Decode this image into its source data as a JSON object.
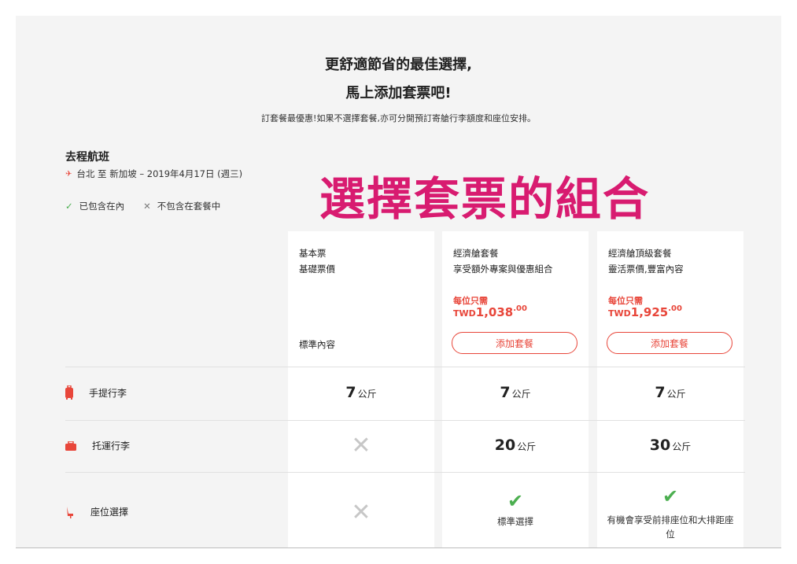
{
  "header": {
    "title_line1": "更舒適節省的最佳選擇,",
    "title_line2": "馬上添加套票吧!",
    "subtitle": "訂套餐最優惠!如果不選擇套餐,亦可分開預訂寄艙行李額度和座位安排。"
  },
  "flight": {
    "title": "去程航班",
    "route": "台北 至 新加坡 – 2019年4月17日 (週三)"
  },
  "legend": {
    "included": "已包含在內",
    "excluded": "不包含在套餐中"
  },
  "overlay_text": "選擇套票的組合",
  "colors": {
    "accent": "#e8463a",
    "check": "#4caf50",
    "overlay": "#d81b70"
  },
  "plans": [
    {
      "name": "基本票",
      "desc": "基礎票價",
      "std": "標準內容"
    },
    {
      "name": "經濟艙套餐",
      "desc": "享受額外專案與優惠組合",
      "price_label": "每位只需",
      "currency": "TWD",
      "amount": "1,038",
      "decimals": ".00",
      "button": "添加套餐"
    },
    {
      "name": "經濟艙頂級套餐",
      "desc": "靈活票價,豐富內容",
      "price_label": "每位只需",
      "currency": "TWD",
      "amount": "1,925",
      "decimals": ".00",
      "button": "添加套餐"
    }
  ],
  "rows": [
    {
      "label": "手提行李",
      "icon": "carry-on-bag-icon",
      "cells": [
        {
          "value": "7",
          "unit": "公斤"
        },
        {
          "value": "7",
          "unit": "公斤"
        },
        {
          "value": "7",
          "unit": "公斤"
        }
      ]
    },
    {
      "label": "托運行李",
      "icon": "checked-bag-icon",
      "cells": [
        {
          "excluded": "✕"
        },
        {
          "value": "20",
          "unit": "公斤"
        },
        {
          "value": "30",
          "unit": "公斤"
        }
      ]
    },
    {
      "label": "座位選擇",
      "icon": "seat-icon",
      "cells": [
        {
          "excluded": "✕"
        },
        {
          "check": "✔",
          "text": "標準選擇"
        },
        {
          "check": "✔",
          "text": "有機會享受前排座位和大排距座位"
        }
      ]
    }
  ]
}
